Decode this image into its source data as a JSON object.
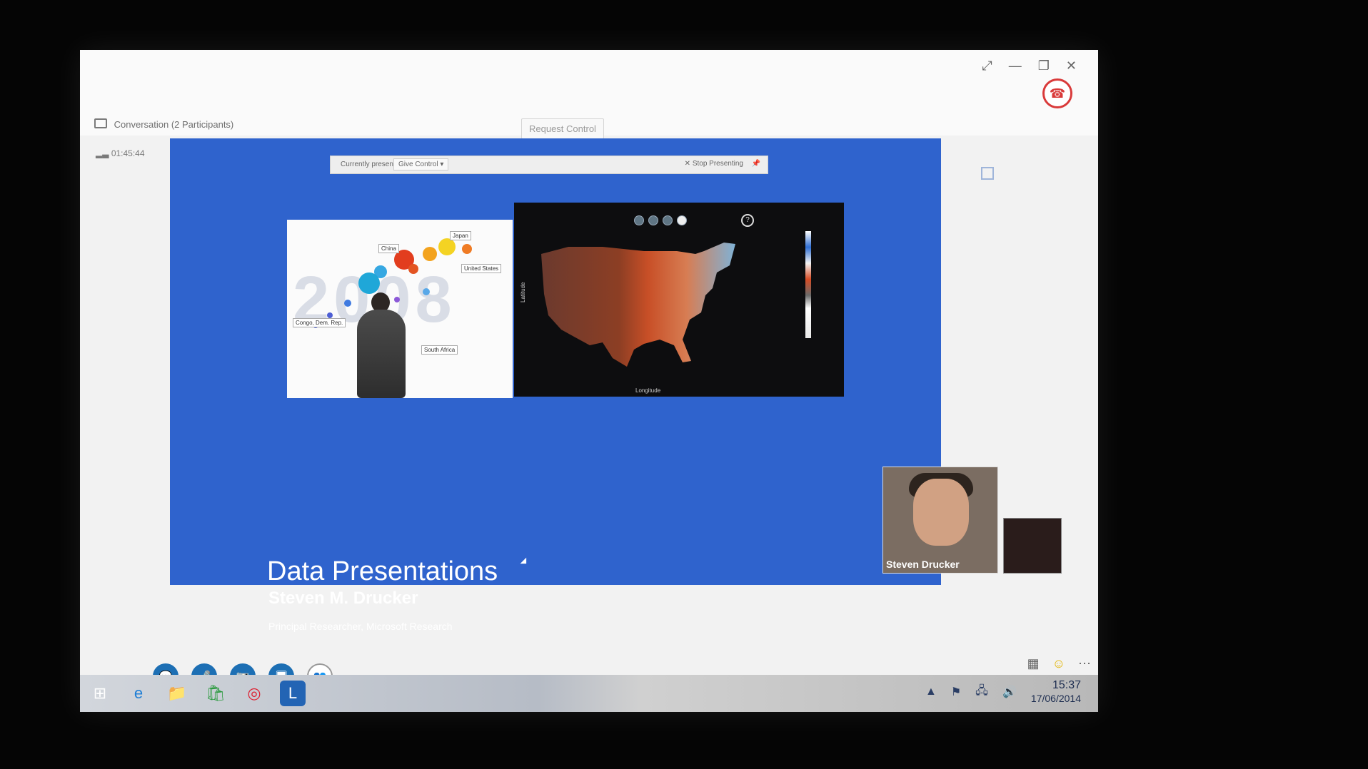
{
  "conversation": {
    "title": "Conversation (2 Participants)",
    "timer": "01:45:44",
    "request_control": "Request Control",
    "currently_presenting": "Currently presenting",
    "give_control": "Give Control ▾",
    "stop_presenting": "✕ Stop Presenting"
  },
  "slide": {
    "title": "Data Presentations",
    "name": "Steven M. Drucker",
    "subtitle": "Principal Researcher, Microsoft Research",
    "year": "2008",
    "countries": [
      "China",
      "Japan",
      "United States",
      "Congo, Dem. Rep.",
      "South Africa"
    ],
    "map_axis_x": "Longitude",
    "map_axis_y": "Latitude"
  },
  "video": {
    "participant_name": "Steven Drucker"
  },
  "taskbar": {
    "time": "15:37",
    "date": "17/06/2014"
  },
  "colors": {
    "share_blue": "#2f63cd",
    "button_blue": "#1d6fb4",
    "hangup_red": "#d93a3a"
  }
}
